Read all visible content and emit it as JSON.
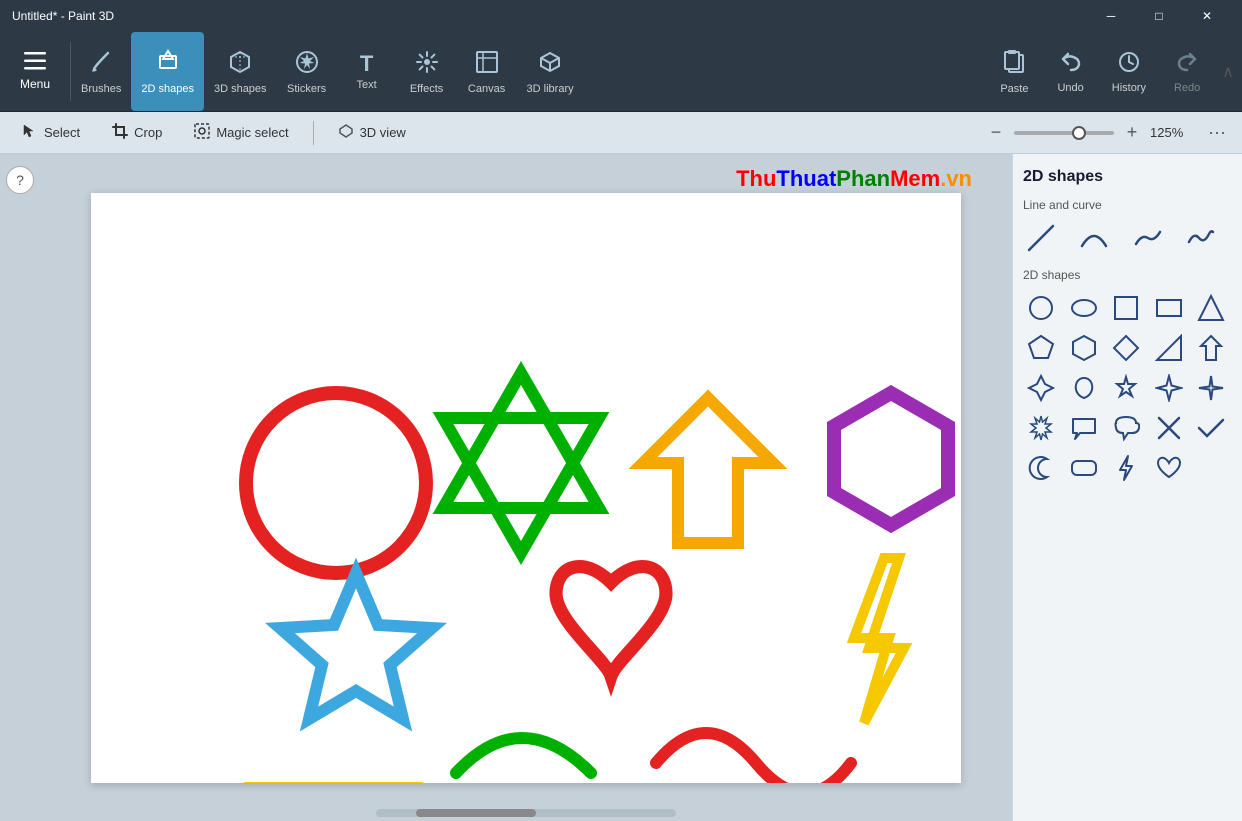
{
  "titlebar": {
    "title": "Untitled* - Paint 3D",
    "min_label": "─",
    "max_label": "□",
    "close_label": "✕"
  },
  "toolbar": {
    "menu_label": "Menu",
    "items": [
      {
        "id": "brushes",
        "label": "Brushes",
        "icon": "✏️"
      },
      {
        "id": "2dshapes",
        "label": "2D shapes",
        "icon": "⬡",
        "active": true
      },
      {
        "id": "3dshapes",
        "label": "3D shapes",
        "icon": "⬡"
      },
      {
        "id": "stickers",
        "label": "Stickers",
        "icon": "⭐"
      },
      {
        "id": "text",
        "label": "Text",
        "icon": "T"
      },
      {
        "id": "effects",
        "label": "Effects",
        "icon": "✨"
      },
      {
        "id": "canvas",
        "label": "Canvas",
        "icon": "⊞"
      },
      {
        "id": "3dlibrary",
        "label": "3D library",
        "icon": "📦"
      }
    ],
    "right_items": [
      {
        "id": "paste",
        "label": "Paste",
        "icon": "📋"
      },
      {
        "id": "undo",
        "label": "Undo",
        "icon": "↩"
      },
      {
        "id": "history",
        "label": "History",
        "icon": "🕐"
      },
      {
        "id": "redo",
        "label": "Redo",
        "icon": "↪"
      }
    ]
  },
  "subtoolbar": {
    "select_label": "Select",
    "crop_label": "Crop",
    "magic_select_label": "Magic select",
    "view3d_label": "3D view",
    "zoom_percent": "125%"
  },
  "watermark": {
    "thu": "Thu",
    "thuat": "Thuat",
    "phan": "Phan",
    "mem": "Mem",
    "vn": ".vn"
  },
  "right_panel": {
    "title": "2D shapes",
    "line_curve_label": "Line and curve",
    "shapes_2d_label": "2D shapes",
    "curve_shapes": [
      "╱",
      "⌒",
      "∿",
      "〰"
    ],
    "shapes_row1": [
      "○",
      "⬭",
      "□",
      "▭",
      "△"
    ],
    "shapes_row2": [
      "⬠",
      "⬡",
      "◇",
      "◺",
      "⬆"
    ],
    "shapes_row3": [
      "△",
      "⌓",
      "☆",
      "✦",
      "✧"
    ],
    "shapes_row4": [
      "✳",
      "💬",
      "💭",
      "✖",
      "✔"
    ],
    "shapes_row5": [
      "☽",
      "⬜",
      "⚡",
      "♡"
    ]
  },
  "help": {
    "label": "?"
  }
}
